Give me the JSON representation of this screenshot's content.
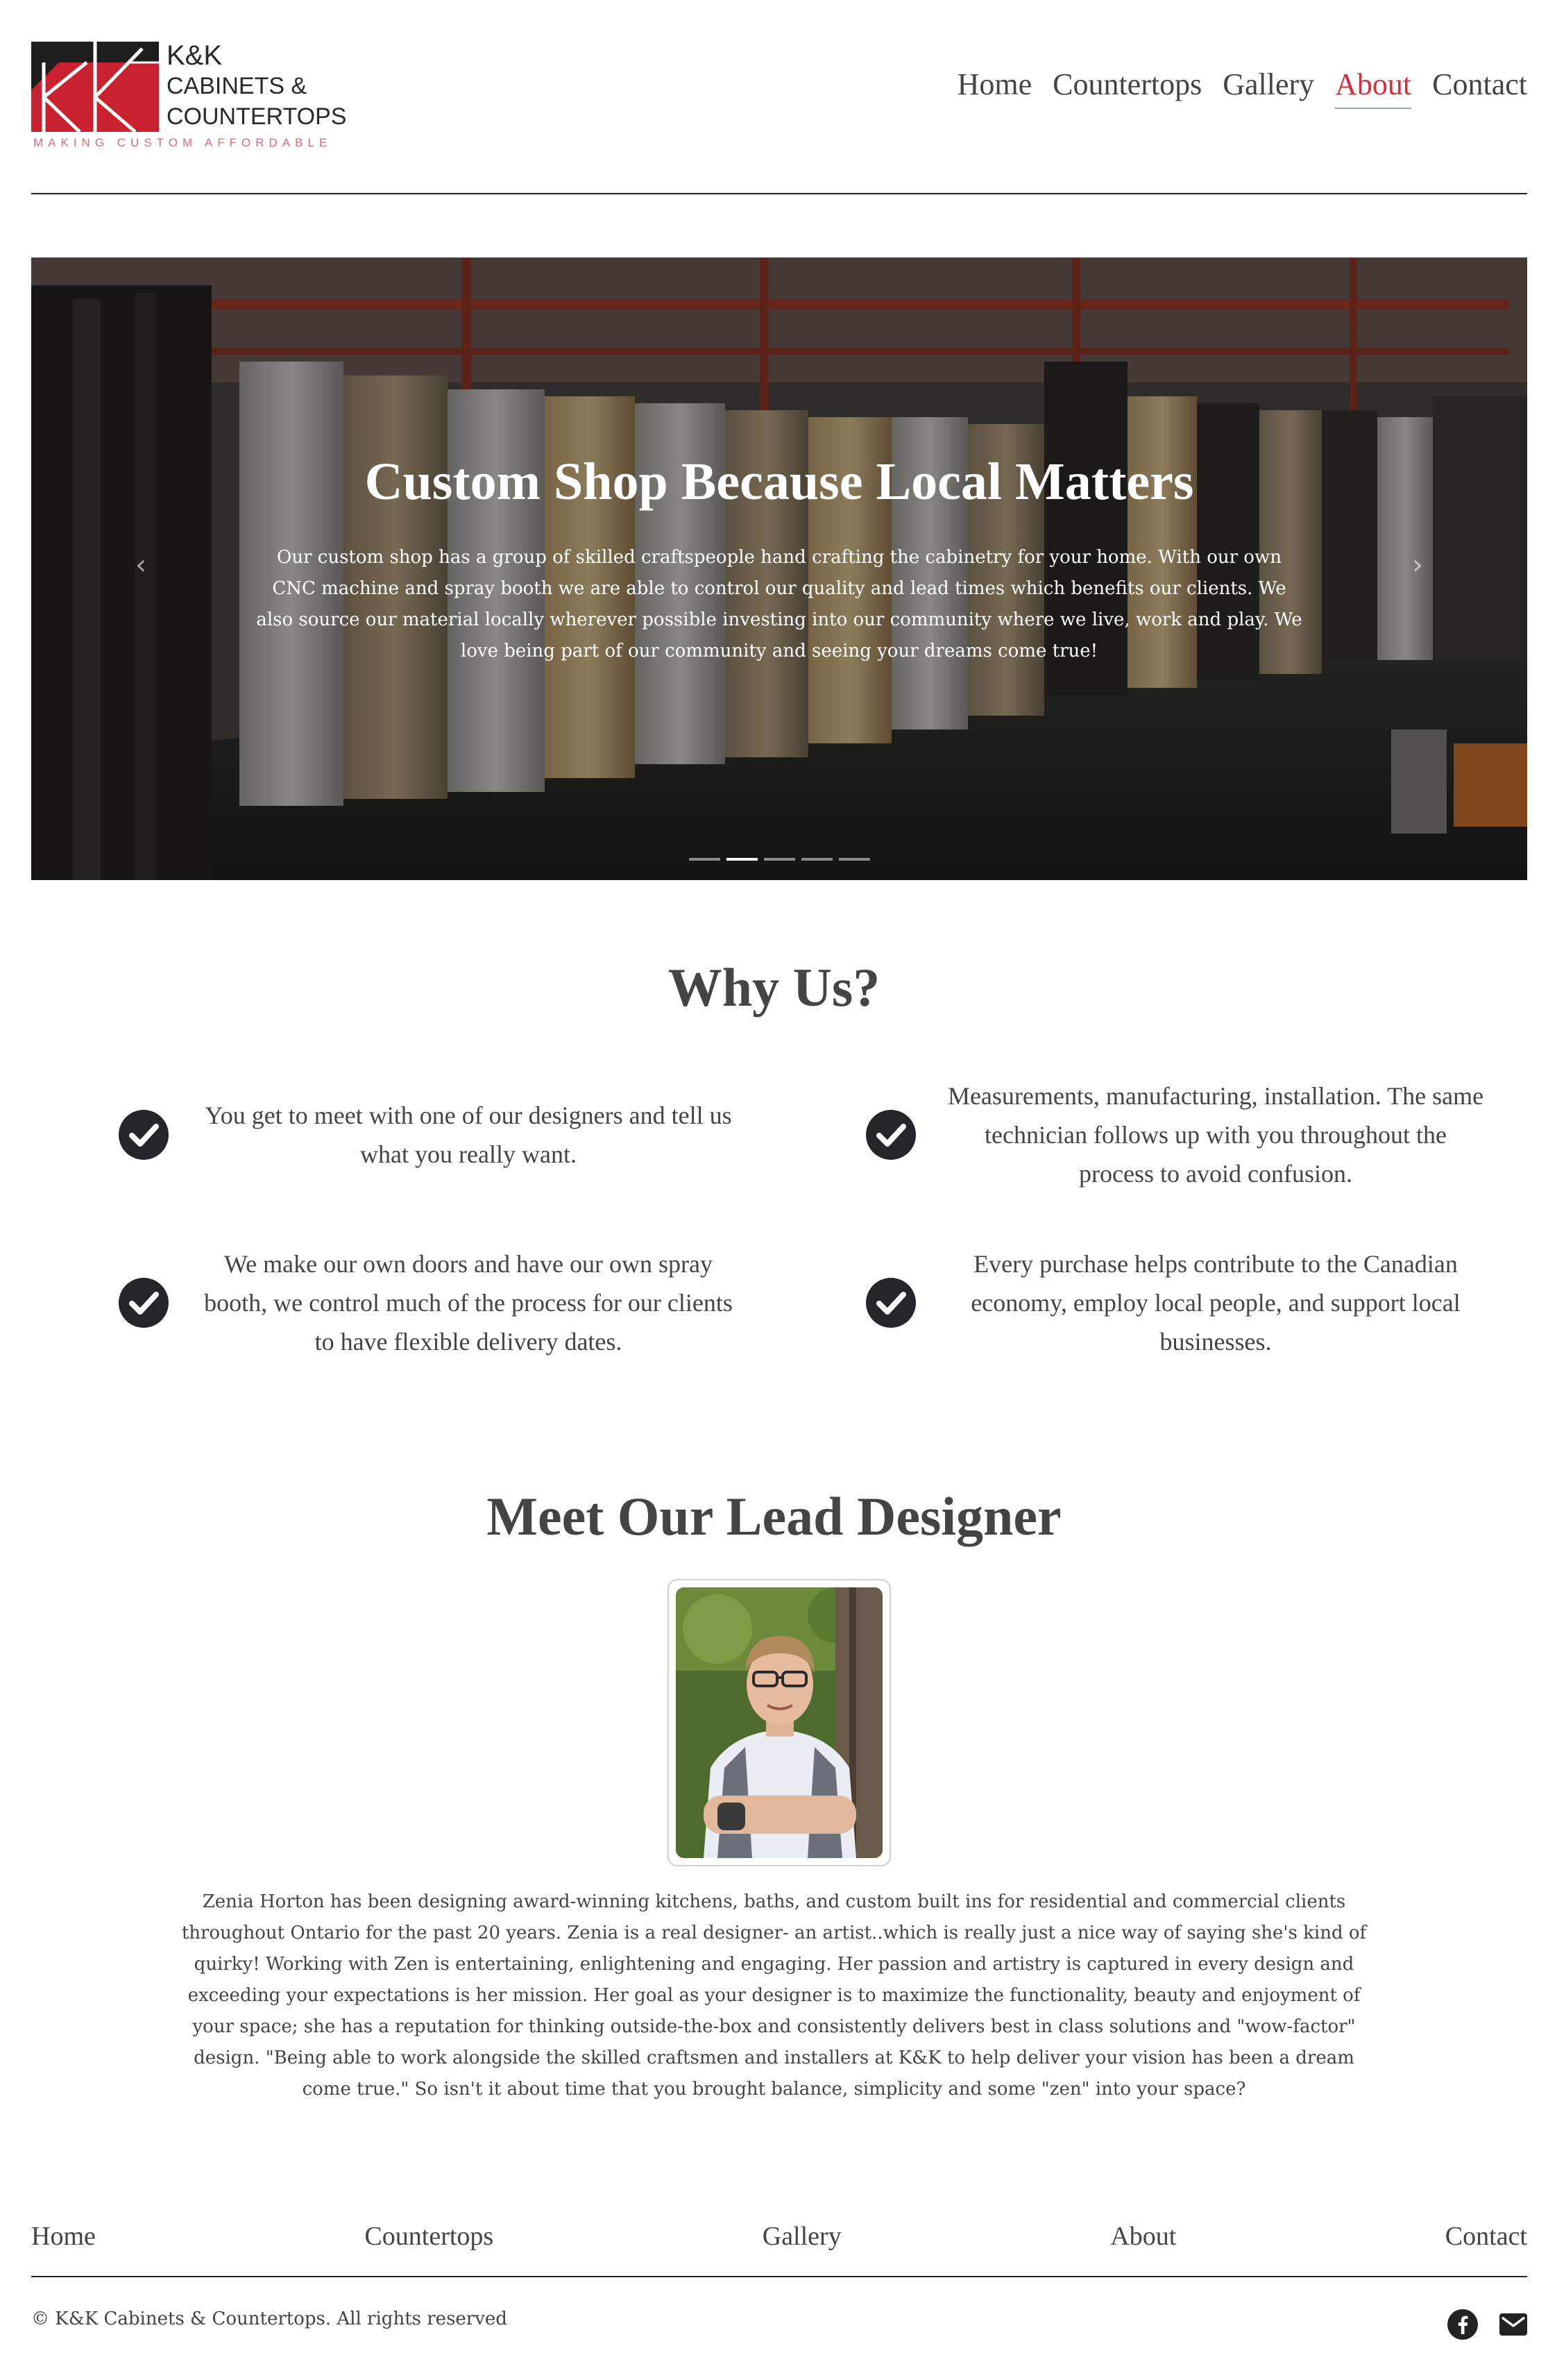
{
  "brand": {
    "name_line1": "K&K",
    "name_line2": "CABINETS &",
    "name_line3": "COUNTERTOPS",
    "tagline": "MAKING CUSTOM AFFORDABLE",
    "colors": {
      "red": "#c8212f",
      "dark": "#2a2a2a"
    }
  },
  "nav": {
    "items": [
      {
        "label": "Home"
      },
      {
        "label": "Countertops"
      },
      {
        "label": "Gallery"
      },
      {
        "label": "About",
        "active": true
      },
      {
        "label": "Contact"
      }
    ],
    "active_color": "#d32f3a"
  },
  "hero": {
    "title": "Custom Shop Because Local Matters",
    "text": "Our custom shop has a group of skilled craftspeople hand crafting the cabinetry for your home. With our own CNC machine and spray booth we are able to control our quality and lead times which benefits our clients. We also source our material locally wherever possible investing into our community where we live, work and play. We love being part of our community and seeing your dreams come true!",
    "prev_icon": "chevron-left-icon",
    "next_icon": "chevron-right-icon",
    "slide_count": 5,
    "active_slide": 2
  },
  "why": {
    "title": "Why Us?",
    "features": [
      {
        "text": "You get to meet with one of our designers and tell us what you really want."
      },
      {
        "text": "Measurements, manufacturing, installation. The same technician follows up with you throughout the process to avoid confusion."
      },
      {
        "text": "We make our own doors and have our own spray booth, we control much of the process for our clients to have flexible delivery dates."
      },
      {
        "text": "Every purchase helps contribute to the Canadian economy, employ local people, and support local businesses."
      }
    ],
    "icon": "check-circle-icon"
  },
  "designer": {
    "title": "Meet Our Lead Designer",
    "bio": "Zenia Horton has been designing award-winning kitchens, baths, and custom built ins for residential and commercial clients throughout Ontario for the past 20 years. Zenia is a real designer- an artist..which is really just a nice way of saying she's kind of quirky! Working with Zen is entertaining, enlightening and engaging. Her passion and artistry is captured in every design and exceeding your expectations is her mission. Her goal as your designer is to maximize the functionality, beauty and enjoyment of your space; she has a reputation for thinking outside-the-box and consistently delivers best in class solutions and \"wow-factor\" design. \"Being able to work alongside the skilled craftsmen and installers at K&K to help deliver your vision has been a dream come true.\" So isn't it about time that you brought balance, simplicity and some \"zen\" into your space?"
  },
  "footer": {
    "nav": [
      {
        "label": "Home"
      },
      {
        "label": "Countertops"
      },
      {
        "label": "Gallery"
      },
      {
        "label": "About"
      },
      {
        "label": "Contact"
      }
    ],
    "copyright": "© K&K Cabinets & Countertops. All rights reserved",
    "social_icons": [
      "facebook-icon",
      "mail-icon"
    ]
  }
}
